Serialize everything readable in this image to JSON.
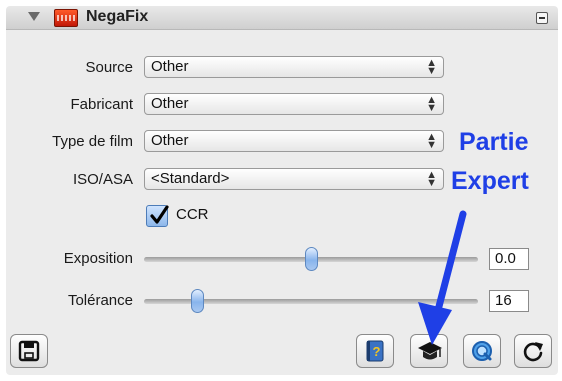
{
  "window": {
    "title": "NegaFix",
    "icons": {
      "disclosure": "disclosure-triangle-icon",
      "app": "negafix-film-icon",
      "collapse": "collapse-panel-icon"
    }
  },
  "form": {
    "source": {
      "label": "Source",
      "value": "Other"
    },
    "fabricant": {
      "label": "Fabricant",
      "value": "Other"
    },
    "film_type": {
      "label": "Type de film",
      "value": "Other"
    },
    "iso": {
      "label": "ISO/ASA",
      "value": "<Standard>"
    },
    "ccr": {
      "label": "CCR",
      "checked": true
    }
  },
  "sliders": {
    "exposition": {
      "label": "Exposition",
      "value_text": "0.0",
      "position": 0.5
    },
    "tolerance": {
      "label": "Tolérance",
      "value_text": "16",
      "position": 0.16
    }
  },
  "buttons": {
    "save": {
      "icon": "floppy-disk-icon"
    },
    "help": {
      "icon": "help-book-icon"
    },
    "expert": {
      "icon": "graduation-cap-icon"
    },
    "preview": {
      "icon": "magnifier-preview-icon"
    },
    "reset": {
      "icon": "refresh-icon"
    }
  },
  "annotation": {
    "line1": "Partie",
    "line2": "Expert",
    "color": "#1f3fe6"
  }
}
